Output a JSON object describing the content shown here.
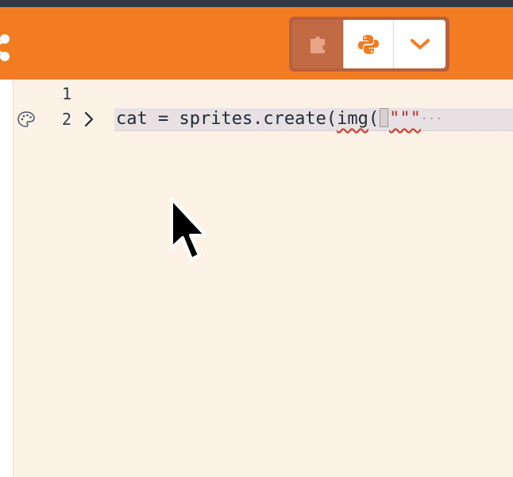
{
  "toolbar": {
    "editor_toggle": {
      "blocks": {
        "icon": "puzzle-piece-icon"
      },
      "python": {
        "icon": "python-logo-icon"
      },
      "dropdown": {
        "icon": "chevron-down-icon"
      }
    },
    "share": {
      "icon": "share-icon"
    }
  },
  "editor": {
    "lines": [
      {
        "number": "1",
        "code": ""
      },
      {
        "number": "2",
        "code_before_error": "cat = sprites.create(",
        "code_error_ident": "img",
        "code_paren": "(",
        "code_string": "\"\"\"",
        "ellipsis": "···"
      }
    ],
    "gutter_icons": [
      "palette-icon",
      "fold-chevron-icon"
    ]
  },
  "colors": {
    "accent": "#f27c22",
    "toggle_bg": "#b9603b",
    "editor_bg": "#fcf3e6",
    "line_highlight": "#e7e1e3",
    "error_squiggle": "#d43a2f"
  }
}
